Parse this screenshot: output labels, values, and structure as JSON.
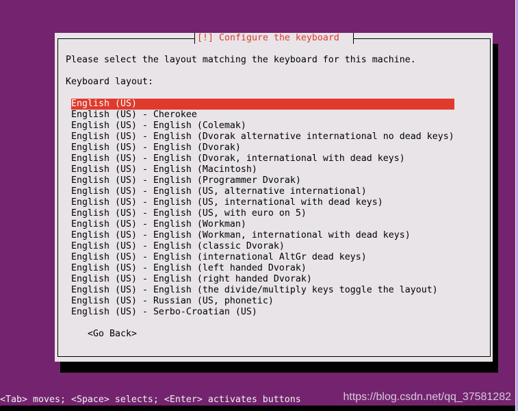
{
  "dialog": {
    "title": "[!] Configure the keyboard",
    "prompt": "Please select the layout matching the keyboard for this machine.",
    "field_label": "Keyboard layout:",
    "selected_index": 0,
    "go_back_label": "<Go Back>"
  },
  "layouts": [
    "English (US)",
    "English (US) - Cherokee",
    "English (US) - English (Colemak)",
    "English (US) - English (Dvorak alternative international no dead keys)",
    "English (US) - English (Dvorak)",
    "English (US) - English (Dvorak, international with dead keys)",
    "English (US) - English (Macintosh)",
    "English (US) - English (Programmer Dvorak)",
    "English (US) - English (US, alternative international)",
    "English (US) - English (US, international with dead keys)",
    "English (US) - English (US, with euro on 5)",
    "English (US) - English (Workman)",
    "English (US) - English (Workman, international with dead keys)",
    "English (US) - English (classic Dvorak)",
    "English (US) - English (international AltGr dead keys)",
    "English (US) - English (left handed Dvorak)",
    "English (US) - English (right handed Dvorak)",
    "English (US) - English (the divide/multiply keys toggle the layout)",
    "English (US) - Russian (US, phonetic)",
    "English (US) - Serbo-Croatian (US)"
  ],
  "status_bar": {
    "hint": "<Tab> moves; <Space> selects; <Enter> activates buttons"
  },
  "watermark": "https://blog.csdn.net/qq_37581282",
  "colors": {
    "background": "#74246f",
    "dialog": "#e8e4e8",
    "accent": "#df3a2b",
    "title_text": "#dd3a2a"
  }
}
